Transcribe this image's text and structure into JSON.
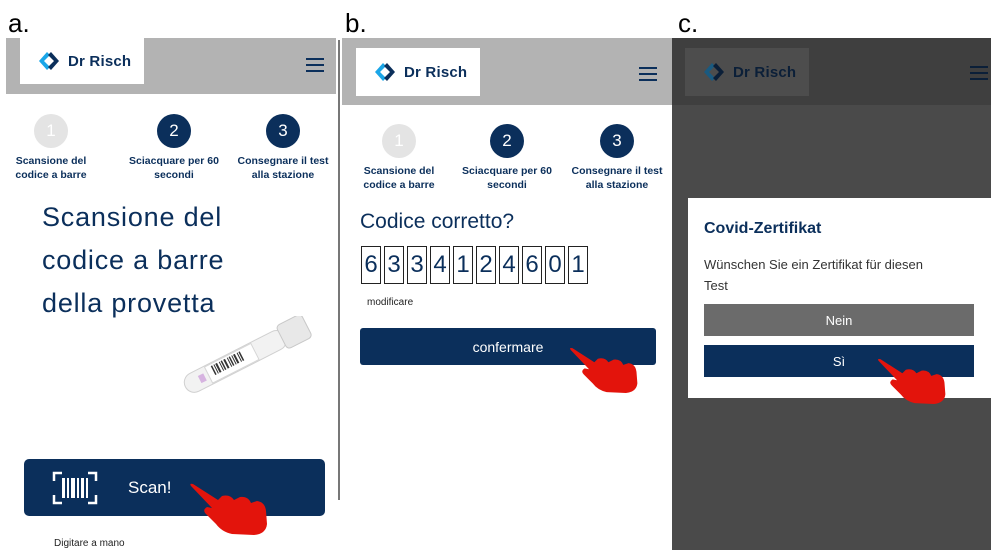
{
  "labels": {
    "a": "a.",
    "b": "b.",
    "c": "c."
  },
  "brand": {
    "name": "Dr Risch"
  },
  "steps": [
    {
      "number": "1",
      "caption_line1": "Scansione del",
      "caption_line2": "codice a barre"
    },
    {
      "number": "2",
      "caption_line1": "Sciacquare per 60",
      "caption_line2": "secondi"
    },
    {
      "number": "3",
      "caption_line1": "Consegnare il test",
      "caption_line2": "alla stazione"
    }
  ],
  "panel_a": {
    "title_line1": "Scansione del",
    "title_line2": "codice a barre",
    "title_line3": "della provetta",
    "scan_label": "Scan!",
    "manual_label": "Digitare a mano"
  },
  "panel_b": {
    "question": "Codice corretto?",
    "digits": [
      "6",
      "3",
      "3",
      "4",
      "1",
      "2",
      "4",
      "6",
      "0",
      "1"
    ],
    "modify_label": "modificare",
    "confirm_label": "confermare"
  },
  "panel_c": {
    "dialog_title": "Covid-Zertifikat",
    "dialog_text_line1": "Wünschen Sie ein Zertifikat für diesen",
    "dialog_text_line2": "Test",
    "no_label": "Nein",
    "yes_label": "Sì"
  },
  "colors": {
    "brand_navy": "#0b2f5b",
    "header_gray": "#b3b3b3",
    "hand_red": "#e3140c",
    "overlay": "#4a4a4a"
  },
  "icons": [
    "logo-icon",
    "menu-icon",
    "barcode-scan-icon",
    "pointing-hand-icon"
  ]
}
